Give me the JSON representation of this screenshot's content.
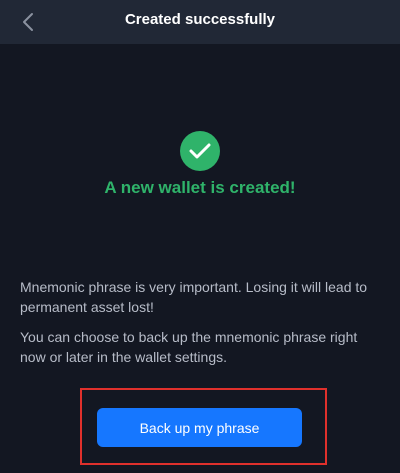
{
  "header": {
    "title": "Created successfully",
    "back_icon": "chevron-left-icon"
  },
  "status": {
    "icon": "check-icon",
    "title": "A new wallet is created!"
  },
  "messages": {
    "warning": "Mnemonic phrase is very important. Losing it will lead to permanent asset lost!",
    "info": "You can choose to back up the mnemonic phrase right now or later in the wallet settings."
  },
  "actions": {
    "backup_label": "Back up my phrase"
  },
  "colors": {
    "background": "#131722",
    "header": "#212836",
    "success": "#2fb36a",
    "primary": "#1677ff",
    "highlight": "#e0302c"
  }
}
